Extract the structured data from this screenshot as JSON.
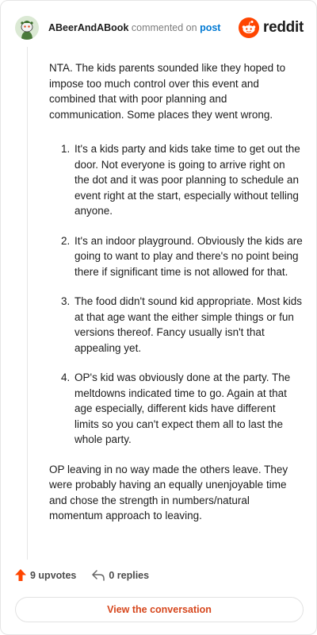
{
  "header": {
    "username": "ABeerAndABook",
    "verb": "commented on",
    "post_link": "post",
    "brand": "reddit"
  },
  "comment": {
    "intro": "NTA. The kids parents sounded like they hoped to impose too much control over this event and combined that with poor planning and communication. Some places they went wrong.",
    "points": [
      "It's a kids party and kids take time to get out the door. Not everyone is going to arrive right on the dot and it was poor planning to schedule an event right at the start, especially without telling anyone.",
      "It's an indoor playground. Obviously the kids are going to want to play and there's no point being there if significant time is not allowed for that.",
      "The food didn't sound kid appropriate. Most kids at that age want the either simple things or fun versions thereof. Fancy usually isn't that appealing yet.",
      "OP's kid was obviously done at the party. The meltdowns indicated time to go. Again at that age especially, different kids have different limits so you can't expect them all to last the whole party."
    ],
    "closing": "OP leaving in no way made the others leave. They were probably having an equally unenjoyable time and chose the strength in numbers/natural momentum approach to leaving."
  },
  "footer": {
    "upvotes": "9 upvotes",
    "replies": "0 replies",
    "view_button": "View the conversation"
  },
  "colors": {
    "upvote_accent": "#ff4500",
    "link": "#0079d3",
    "button_text": "#d6461c"
  },
  "icons": {
    "avatar": "snoo-avatar",
    "logo": "reddit-logo-icon",
    "upvote": "upvote-arrow-icon",
    "reply": "reply-arrow-icon"
  }
}
